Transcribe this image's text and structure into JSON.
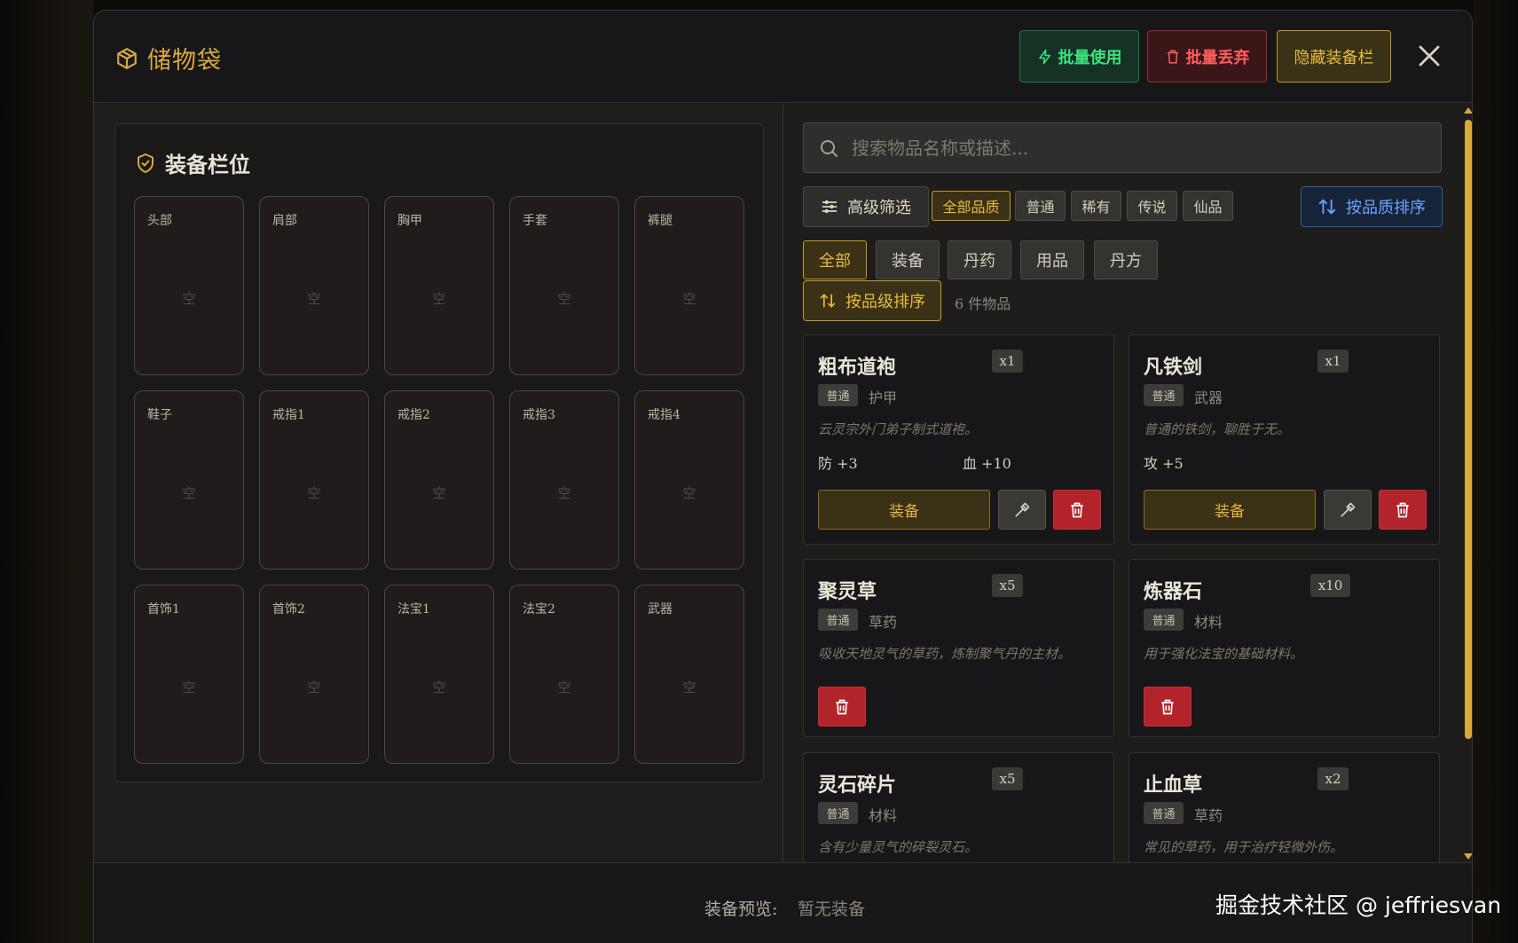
{
  "header": {
    "title": "储物袋",
    "batch_use": "批量使用",
    "batch_drop": "批量丢弃",
    "hide_equip": "隐藏装备栏"
  },
  "equipment": {
    "title": "装备栏位",
    "empty_text": "空",
    "slots": [
      "头部",
      "肩部",
      "胸甲",
      "手套",
      "裤腿",
      "鞋子",
      "戒指1",
      "戒指2",
      "戒指3",
      "戒指4",
      "首饰1",
      "首饰2",
      "法宝1",
      "法宝2",
      "武器"
    ]
  },
  "inventory": {
    "search_placeholder": "搜索物品名称或描述...",
    "advanced_filter": "高级筛选",
    "quality_filters": [
      "全部品质",
      "普通",
      "稀有",
      "传说",
      "仙品"
    ],
    "sort_quality": "按品质排序",
    "categories": [
      "全部",
      "装备",
      "丹药",
      "用品",
      "丹方"
    ],
    "sort_level": "按品级排序",
    "item_count": "6 件物品",
    "equip_label": "装备",
    "items": [
      {
        "name": "粗布道袍",
        "qty": "x1",
        "rarity": "普通",
        "type": "护甲",
        "desc": "云灵宗外门弟子制式道袍。",
        "stats": [
          "防 +3",
          "血 +10"
        ]
      },
      {
        "name": "凡铁剑",
        "qty": "x1",
        "rarity": "普通",
        "type": "武器",
        "desc": "普通的铁剑，聊胜于无。",
        "stats": [
          "攻 +5"
        ]
      },
      {
        "name": "聚灵草",
        "qty": "x5",
        "rarity": "普通",
        "type": "草药",
        "desc": "吸收天地灵气的草药，炼制聚气丹的主材。"
      },
      {
        "name": "炼器石",
        "qty": "x10",
        "rarity": "普通",
        "type": "材料",
        "desc": "用于强化法宝的基础材料。"
      },
      {
        "name": "灵石碎片",
        "qty": "x5",
        "rarity": "普通",
        "type": "材料",
        "desc": "含有少量灵气的碎裂灵石。"
      },
      {
        "name": "止血草",
        "qty": "x2",
        "rarity": "普通",
        "type": "草药",
        "desc": "常见的草药，用于治疗轻微外伤。"
      }
    ]
  },
  "footer": {
    "preview_label": "装备预览:",
    "preview_value": "暂无装备"
  },
  "watermark": "掘金技术社区 @ jeffriesvan",
  "colors": {
    "accent_gold": "#d9a83f",
    "success_green": "#3ee07f",
    "danger_red": "#b3232b",
    "info_blue": "#6aa3ff"
  }
}
